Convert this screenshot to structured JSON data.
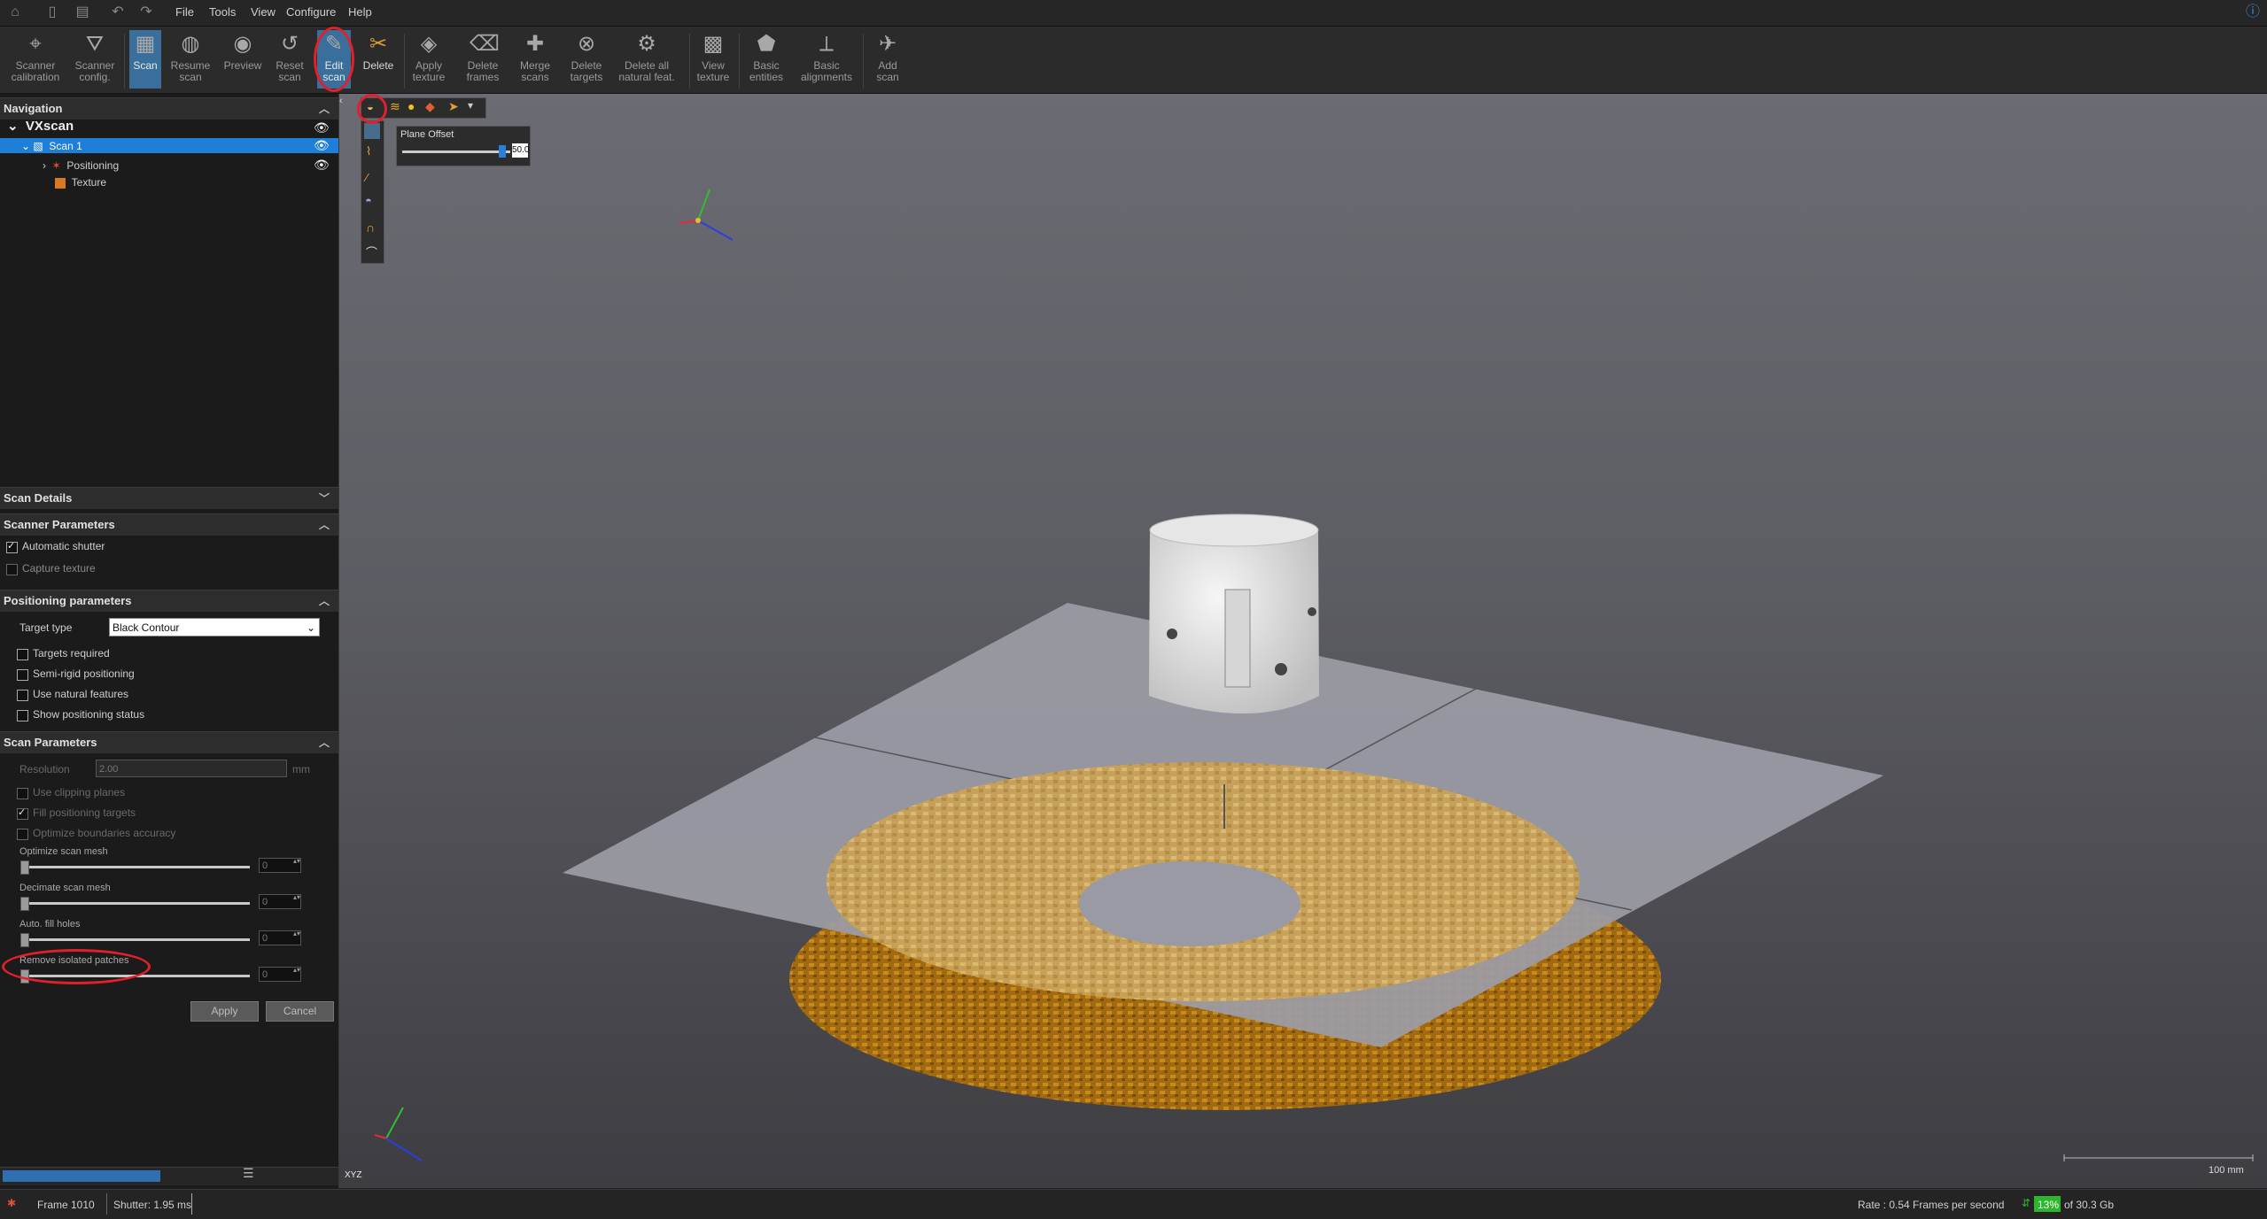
{
  "menu": [
    "File",
    "Tools",
    "View",
    "Configure",
    "Help"
  ],
  "ribbon": {
    "tools": [
      {
        "label1": "Scanner",
        "label2": "calibration",
        "icon": "crosshair-icon"
      },
      {
        "label1": "Scanner",
        "label2": "config.",
        "icon": "scanner-icon"
      },
      {
        "label1": "Scan",
        "label2": "",
        "icon": "scan-icon"
      },
      {
        "label1": "Resume",
        "label2": "scan",
        "icon": "resume-icon"
      },
      {
        "label1": "Preview",
        "label2": "",
        "icon": "preview-icon"
      },
      {
        "label1": "Reset",
        "label2": "scan",
        "icon": "reset-icon"
      },
      {
        "label1": "Edit",
        "label2": "scan",
        "icon": "edit-scan-icon"
      },
      {
        "label1": "Delete",
        "label2": "",
        "icon": "delete-icon"
      },
      {
        "label1": "Apply",
        "label2": "texture",
        "icon": "apply-texture-icon"
      },
      {
        "label1": "Delete",
        "label2": "frames",
        "icon": "delete-frames-icon"
      },
      {
        "label1": "Merge",
        "label2": "scans",
        "icon": "merge-icon"
      },
      {
        "label1": "Delete",
        "label2": "targets",
        "icon": "delete-targets-icon"
      },
      {
        "label1": "Delete all",
        "label2": "natural feat.",
        "icon": "delete-natural-icon"
      },
      {
        "label1": "View",
        "label2": "texture",
        "icon": "view-texture-icon"
      },
      {
        "label1": "Basic",
        "label2": "entities",
        "icon": "entities-icon"
      },
      {
        "label1": "Basic",
        "label2": "alignments",
        "icon": "alignments-icon"
      },
      {
        "label1": "Add",
        "label2": "scan",
        "icon": "add-scan-icon"
      }
    ]
  },
  "navigation": {
    "title": "Navigation",
    "root": "VXscan",
    "scan": "Scan 1",
    "children": [
      "Positioning",
      "Texture"
    ]
  },
  "scan_details": {
    "title": "Scan Details"
  },
  "scanner_params": {
    "title": "Scanner Parameters",
    "automatic_shutter": "Automatic shutter",
    "capture_texture": "Capture texture"
  },
  "positioning": {
    "title": "Positioning parameters",
    "target_type_label": "Target type",
    "target_type_value": "Black Contour",
    "options": [
      "Targets required",
      "Semi-rigid positioning",
      "Use natural features",
      "Show positioning status"
    ]
  },
  "scan_params": {
    "title": "Scan Parameters",
    "resolution_label": "Resolution",
    "resolution_value": "2.00",
    "resolution_unit": "mm",
    "options": [
      "Use clipping planes",
      "Fill positioning targets",
      "Optimize boundaries accuracy"
    ],
    "sliders": [
      {
        "label": "Optimize scan mesh",
        "value": "0"
      },
      {
        "label": "Decimate scan mesh",
        "value": "0"
      },
      {
        "label": "Auto. fill holes",
        "value": "0"
      },
      {
        "label": "Remove isolated patches",
        "value": "0"
      }
    ],
    "apply": "Apply",
    "cancel": "Cancel"
  },
  "edit_toolbar": {
    "plane_offset_label": "Plane Offset",
    "plane_offset_value": "50.0"
  },
  "viewport": {
    "axis_label": "XYZ",
    "scale_label": "100 mm"
  },
  "status": {
    "frame": "Frame 1010",
    "shutter": "Shutter: 1.95 ms",
    "rate": "Rate : 0.54 Frames per second",
    "memory_pct": "13%",
    "memory_total": "of 30.3 Gb"
  },
  "colors": {
    "accent": "#3a6f9c",
    "selection": "#1e7fd8",
    "highlight_circle": "#e0202a",
    "memory_green": "#2db52d"
  }
}
